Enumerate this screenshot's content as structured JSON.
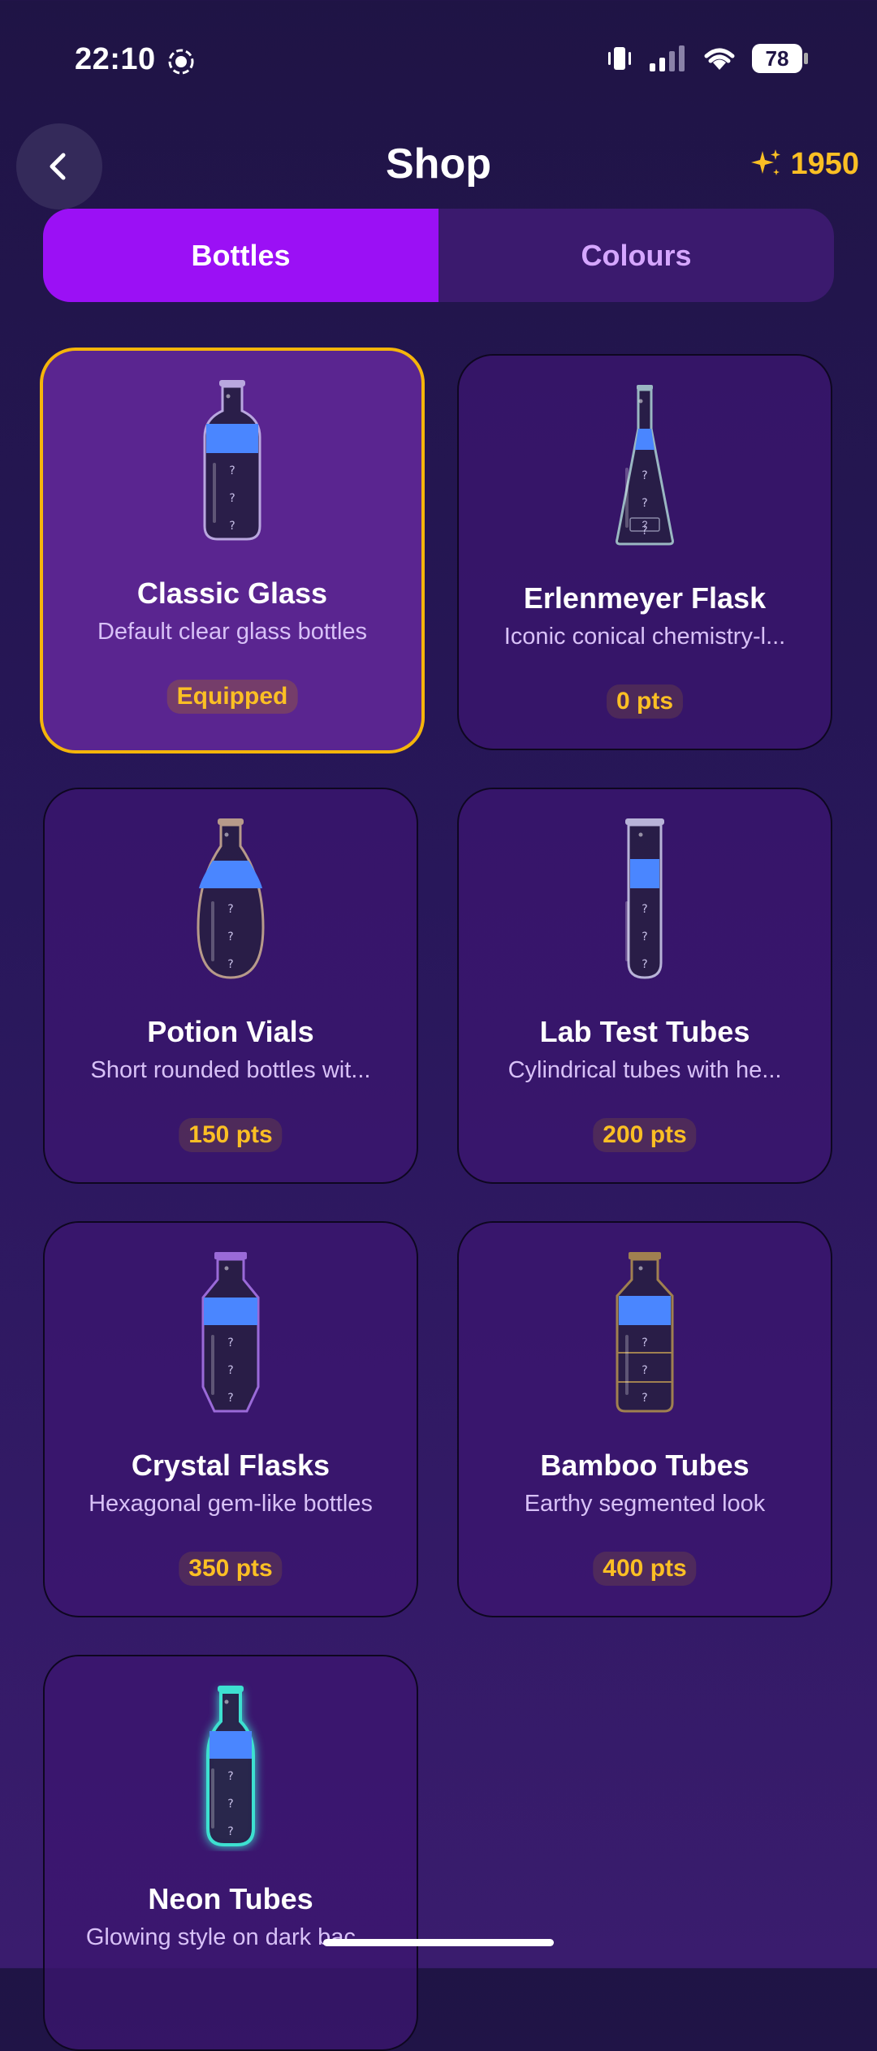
{
  "status_bar": {
    "time": "22:10",
    "battery": "78"
  },
  "header": {
    "title": "Shop",
    "points_icon": "sparkles-icon",
    "points": "1950"
  },
  "tabs": [
    {
      "label": "Bottles",
      "active": true
    },
    {
      "label": "Colours",
      "active": false
    }
  ],
  "items": [
    {
      "name": "Classic Glass",
      "desc": "Default clear glass bottles",
      "price": "Equipped",
      "equipped": true,
      "shape": "classic",
      "outline": "#b9a7df"
    },
    {
      "name": "Erlenmeyer Flask",
      "desc": "Iconic conical chemistry-l...",
      "price": "0 pts",
      "equipped": false,
      "shape": "erlenmeyer",
      "outline": "#9ab7c2"
    },
    {
      "name": "Potion Vials",
      "desc": "Short rounded bottles wit...",
      "price": "150 pts",
      "equipped": false,
      "shape": "potion",
      "outline": "#b79a8a"
    },
    {
      "name": "Lab Test Tubes",
      "desc": "Cylindrical tubes with he...",
      "price": "200 pts",
      "equipped": false,
      "shape": "testtube",
      "outline": "#b8b3d8"
    },
    {
      "name": "Crystal Flasks",
      "desc": "Hexagonal gem-like bottles",
      "price": "350 pts",
      "equipped": false,
      "shape": "crystal",
      "outline": "#9a6ad8"
    },
    {
      "name": "Bamboo Tubes",
      "desc": "Earthy segmented look",
      "price": "400 pts",
      "equipped": false,
      "shape": "bamboo",
      "outline": "#a08050"
    },
    {
      "name": "Neon Tubes",
      "desc": "Glowing style on dark bac...",
      "price": "",
      "equipped": false,
      "shape": "neon",
      "outline": "#3de0d0"
    }
  ],
  "colors": {
    "accent": "#9b10f5",
    "gold": "#fbbf24",
    "liquid": "#4a86ff"
  }
}
